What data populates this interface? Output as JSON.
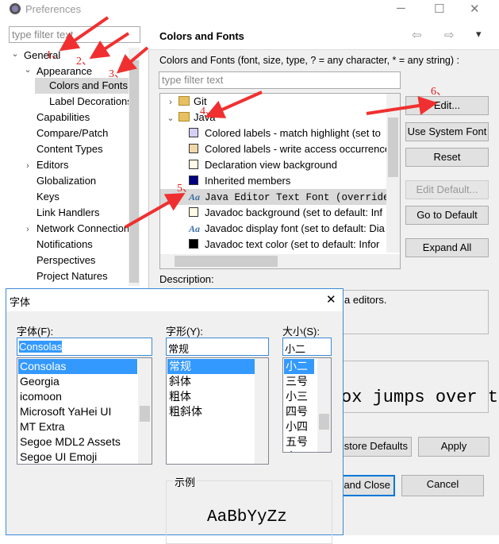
{
  "window": {
    "title": "Preferences",
    "minimize": "─",
    "maximize": "☐",
    "close": "✕"
  },
  "left": {
    "filter_placeholder": "type filter text",
    "tree": [
      {
        "label": "General",
        "level": 0,
        "expander": "expanded"
      },
      {
        "label": "Appearance",
        "level": 1,
        "expander": "expanded"
      },
      {
        "label": "Colors and Fonts",
        "level": 2,
        "selected": true
      },
      {
        "label": "Label Decorations",
        "level": 2
      },
      {
        "label": "Capabilities",
        "level": 1
      },
      {
        "label": "Compare/Patch",
        "level": 1
      },
      {
        "label": "Content Types",
        "level": 1
      },
      {
        "label": "Editors",
        "level": 1,
        "expander": "collapsed"
      },
      {
        "label": "Globalization",
        "level": 1
      },
      {
        "label": "Keys",
        "level": 1
      },
      {
        "label": "Link Handlers",
        "level": 1
      },
      {
        "label": "Network Connections",
        "level": 1,
        "expander": "collapsed"
      },
      {
        "label": "Notifications",
        "level": 1
      },
      {
        "label": "Perspectives",
        "level": 1
      },
      {
        "label": "Project Natures",
        "level": 1
      }
    ]
  },
  "right": {
    "title": "Colors and Fonts",
    "nav": {
      "back": "⇦",
      "forward": "⇨",
      "menu": "▾"
    },
    "description": "Colors and Fonts (font, size, type, ? = any character, * = any string) :",
    "filter_placeholder": "type filter text",
    "tree": [
      {
        "label": "Git",
        "type": "folder",
        "expander": "collapsed"
      },
      {
        "label": "Java",
        "type": "folder",
        "expander": "expanded"
      },
      {
        "label": "Colored labels - match highlight (set to",
        "type": "color",
        "color": "#d4d0f5"
      },
      {
        "label": "Colored labels - write access occurrences",
        "type": "color",
        "color": "#f0d8a8"
      },
      {
        "label": "Declaration view background",
        "type": "color",
        "color": "#fffbe6"
      },
      {
        "label": "Inherited members",
        "type": "color",
        "color": "#000080"
      },
      {
        "label": "Java Editor Text Font (overrides",
        "type": "font",
        "selected": true
      },
      {
        "label": "Javadoc background (set to default: Inf",
        "type": "color",
        "color": "#fffbe6"
      },
      {
        "label": "Javadoc display font (set to default: Dia",
        "type": "font"
      },
      {
        "label": "Javadoc text color (set to default: Infor",
        "type": "color",
        "color": "#000000"
      }
    ],
    "buttons": {
      "edit": "Edit...",
      "use_system_font": "Use System Font",
      "reset": "Reset",
      "edit_default": "Edit Default...",
      "go_to_default": "Go to Default",
      "expand_all": "Expand All"
    },
    "description_label": "Description:",
    "description_text": "a editors.",
    "preview_text": "ox jumps over t",
    "restore_defaults": "store Defaults",
    "apply": "Apply",
    "apply_and_close": "and Close",
    "cancel": "Cancel"
  },
  "font_dialog": {
    "title": "字体",
    "close": "✕",
    "font_label": "字体(F):",
    "font_value": "Consolas",
    "fonts": [
      "Consolas",
      "Georgia",
      "icomoon",
      "Microsoft YaHei UI",
      "MT Extra",
      "Segoe MDL2 Assets",
      "Segoe UI Emoji"
    ],
    "style_label": "字形(Y):",
    "style_value": "常规",
    "styles": [
      "常规",
      "斜体",
      "粗体",
      "粗斜体"
    ],
    "size_label": "大小(S):",
    "size_value": "小二",
    "sizes": [
      "小二",
      "三号",
      "小三",
      "四号",
      "小四",
      "五号",
      "小五"
    ],
    "sample_label": "示例",
    "sample_text": "AaBbYyZz"
  },
  "annotations": [
    "1、",
    "2、",
    "3、",
    "4、",
    "5、",
    "6、"
  ],
  "colors": {
    "selection": "#3399ff",
    "annotation": "#e02020",
    "tree_selected": "#d9d9d9"
  }
}
